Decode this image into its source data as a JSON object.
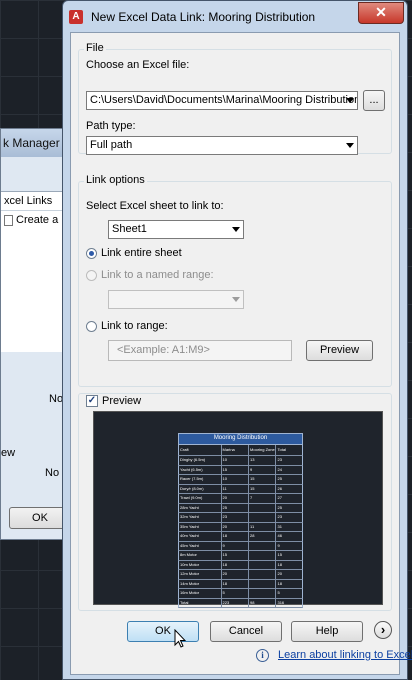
{
  "background_window": {
    "title": "k Manager",
    "tree_header": "xcel Links",
    "tree_item": "Create a n",
    "text1": "No",
    "text2": "ew",
    "text3": "No",
    "ok_label": "OK"
  },
  "dialog": {
    "title": "New Excel Data Link: Mooring Distribution",
    "app_icon": "A",
    "close_glyph": "✕"
  },
  "file_group": {
    "label": "File",
    "choose_label": "Choose an Excel file:",
    "file_value": "C:\\Users\\David\\Documents\\Marina\\Mooring Distribution",
    "browse_label": "...",
    "path_type_label": "Path type:",
    "path_type_value": "Full path"
  },
  "link_options": {
    "label": "Link options",
    "select_sheet_label": "Select Excel sheet to link to:",
    "sheet_value": "Sheet1",
    "radio_entire": "Link entire sheet",
    "radio_named": "Link to a named range:",
    "named_range_value": "",
    "radio_range": "Link to range:",
    "range_placeholder": "<Example: A1:M9>",
    "preview_button": "Preview",
    "selected_option": "entire"
  },
  "preview": {
    "checkbox_label": "Preview",
    "checked": true,
    "table_title": "Mooring Distribution",
    "headers": [
      "Craft",
      "Marina",
      "Mooring Zone",
      "Total"
    ],
    "rows": [
      [
        "Dinghy (6.5m)",
        "10",
        "13",
        "23"
      ],
      [
        "Yacht (6.5m)",
        "15",
        "9",
        "24"
      ],
      [
        "Racer (7.5m)",
        "10",
        "15",
        "25"
      ],
      [
        "Dory/r (8.0m)",
        "11",
        "15",
        "26"
      ],
      [
        "Trawl (9.0m)",
        "20",
        "7",
        "27"
      ],
      [
        "28m Yacht",
        "25",
        "",
        "25"
      ],
      [
        "32m Yacht",
        "23",
        "",
        "23"
      ],
      [
        "35m Yacht",
        "20",
        "11",
        "31"
      ],
      [
        "40m Yacht",
        "18",
        "28",
        "46"
      ],
      [
        "45m Yacht",
        "9",
        "",
        "9"
      ],
      [
        "8m Motor",
        "15",
        "",
        "15"
      ],
      [
        "10m Motor",
        "18",
        "",
        "18"
      ],
      [
        "12m Motor",
        "20",
        "",
        "20"
      ],
      [
        "14m Motor",
        "18",
        "",
        "18"
      ],
      [
        "16m Motor",
        "5",
        "",
        "5"
      ],
      [
        "Total",
        "223",
        "98",
        "316"
      ]
    ]
  },
  "buttons": {
    "ok": "OK",
    "cancel": "Cancel",
    "help": "Help",
    "more": "›"
  },
  "footer": {
    "info_glyph": "i",
    "link": "Learn about linking to Excel"
  },
  "colors": {
    "dialog_frame": "#c5d6ea",
    "client_bg": "#f0f0f0",
    "link": "#0b3fa1",
    "close_red": "#c7372a",
    "preview_bg": "#1f242c",
    "table_title_bg": "#2d5a9e"
  }
}
